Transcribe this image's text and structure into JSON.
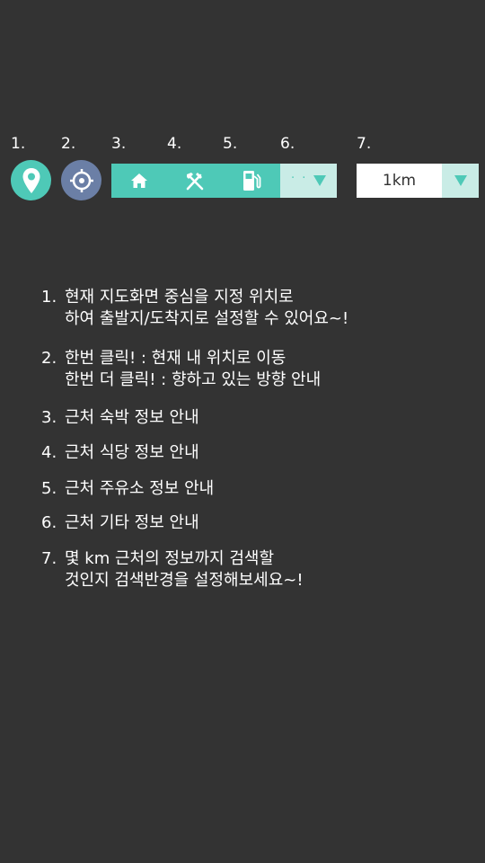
{
  "numbers": [
    "1.",
    "2.",
    "3.",
    "4.",
    "5.",
    "6.",
    "7."
  ],
  "toolbar": {
    "location_pin_icon": "map-pin",
    "current_location_icon": "crosshair-target",
    "categories": [
      {
        "icon": "home"
      },
      {
        "icon": "fork-knife"
      },
      {
        "icon": "gas-pump"
      },
      {
        "icon": "more-dots",
        "text": "· ·"
      }
    ],
    "radius": {
      "value": "1km"
    }
  },
  "descriptions": [
    {
      "num": "1.",
      "lines": [
        "현재 지도화면 중심을 지정 위치로",
        "하여 출발지/도착지로 설정할 수 있어요~!"
      ]
    },
    {
      "num": "2.",
      "lines": [
        "한번 클릭! : 현재 내 위치로 이동",
        "한번 더 클릭! : 향하고 있는 방향 안내"
      ]
    },
    {
      "num": "3.",
      "lines": [
        "근처 숙박 정보 안내"
      ]
    },
    {
      "num": "4.",
      "lines": [
        "근처 식당 정보 안내"
      ]
    },
    {
      "num": "5.",
      "lines": [
        "근처 주유소 정보 안내"
      ]
    },
    {
      "num": "6.",
      "lines": [
        "근처 기타 정보 안내"
      ]
    },
    {
      "num": "7.",
      "lines": [
        "몇 km 근처의 정보까지 검색할",
        "것인지 검색반경을 설정해보세요~!"
      ]
    }
  ],
  "colors": {
    "background": "#333333",
    "accent_teal": "#4ec9b7",
    "light_teal": "#c9ece6",
    "target_blue": "#6b7fa6"
  }
}
